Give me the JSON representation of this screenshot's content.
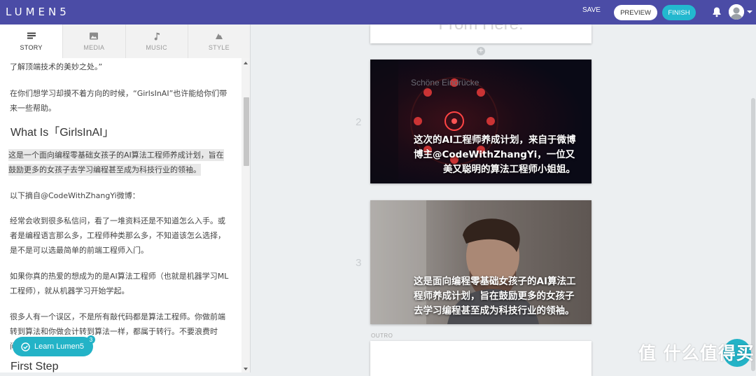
{
  "topbar": {
    "logo": "LUMEN5",
    "save_label": "SAVE",
    "preview_label": "PREVIEW",
    "finish_label": "FINISH"
  },
  "tabs": [
    {
      "label": "STORY",
      "icon": "story-icon",
      "active": true
    },
    {
      "label": "MEDIA",
      "icon": "media-icon",
      "active": false
    },
    {
      "label": "MUSIC",
      "icon": "music-icon",
      "active": false
    },
    {
      "label": "STYLE",
      "icon": "style-icon",
      "active": false
    }
  ],
  "story": {
    "p1": "了解顶端技术的美妙之处。”",
    "p2a": "在你们想学习却摸不着方向的时候，“GirlsInAI”也许能给你们带",
    "p2b": "来一些帮助。",
    "h_what": "What Is「GirlsInAI」",
    "hl1": "这是一个面向编程零基础女孩子的AI算法工程师养成计划，旨在",
    "hl2": "鼓励更多的女孩子去学习编程甚至成为科技行业的领袖。",
    "p3": "以下摘自@CodeWithZhangYi微博：",
    "p4a": "经常会收到很多私信问，看了一堆资料还是不知道怎么入手。或",
    "p4b": "者是编程语言那么多，工程师种类那么多，不知道该怎么选择，",
    "p4c": "是不是可以选最简单的前端工程师入门。",
    "p5a": "如果你真的热爱的想成为的是AI算法工程师（也就是机器学习ML",
    "p5b": "工程师），就从机器学习开始学起。",
    "p6a": "很多人有一个误区，不是所有敲代码都是算法工程师。你做前端",
    "p6b": "转到算法和你做会计转到算法一样，都属于转行。不要浪费时",
    "p6c": "间",
    "h_first": "First Step"
  },
  "learn": {
    "label": "Learn Lumen5",
    "badge": "3"
  },
  "scenes": {
    "top_partial_text": "From Here.",
    "s2": {
      "number": "2",
      "bg_text": "Schöne Eindrücke",
      "line1": "这次的AI工程师养成计划，来自于微博",
      "line2": "博主@CodeWithZhangYi，一位又",
      "line3": "美又聪明的算法工程师小姐姐。"
    },
    "s3": {
      "number": "3",
      "line1": "这是面向编程零基础女孩子的AI算法工",
      "line2": "程师养成计划，旨在鼓励更多的女孩子",
      "line3": "去学习编程甚至成为科技行业的领袖。"
    },
    "outro_label": "OUTRO"
  },
  "watermark": "值 什么值得买",
  "colors": {
    "topbar": "#4b4ca6",
    "accent": "#23b8cf"
  }
}
